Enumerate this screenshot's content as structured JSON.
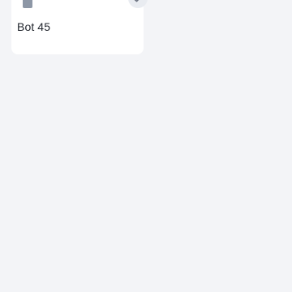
{
  "bot_card": {
    "name": "Bot 45",
    "avatar_icon": "bot-avatar-icon",
    "status_icon": "checkmark-icon",
    "colors": {
      "background": "#f3f4f7",
      "card": "#ffffff",
      "avatar": "#8d97a6",
      "text": "#1f232b",
      "check": "#6b7280"
    }
  }
}
